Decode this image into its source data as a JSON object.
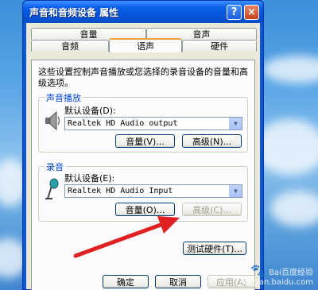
{
  "window": {
    "title": "声音和音频设备 属性",
    "help_label": "?",
    "close_label": "×"
  },
  "tabs": {
    "top_row": [
      "音量",
      "音声"
    ],
    "bottom_row": [
      "音频",
      "语声",
      "硬件"
    ],
    "active": "语声"
  },
  "panel": {
    "description": "这些设置控制声音播放或您选择的录音设备的音量和高级选项。"
  },
  "playback": {
    "group_label": "声音播放",
    "device_label": "默认设备(D):",
    "device_value": "Realtek HD Audio output",
    "volume_button": "音量(V)...",
    "advanced_button": "高级(N)..."
  },
  "recording": {
    "group_label": "录音",
    "device_label": "默认设备(E):",
    "device_value": "Realtek HD Audio Input",
    "volume_button": "音量(O)...",
    "advanced_button": "高级(C)..."
  },
  "test_hardware_button": "测试硬件(T)...",
  "dialog_buttons": {
    "ok": "确定",
    "cancel": "取消",
    "apply": "应用(A)"
  },
  "watermark": {
    "text": "Bai百度经验",
    "sub": "jingyan.baidu.com"
  },
  "colors": {
    "titlebar": "#0553d6",
    "client_bg": "#ece9d8",
    "group_label": "#0046d5",
    "arrow": "#e02020",
    "active_tab_accent": "#f1a33a"
  }
}
